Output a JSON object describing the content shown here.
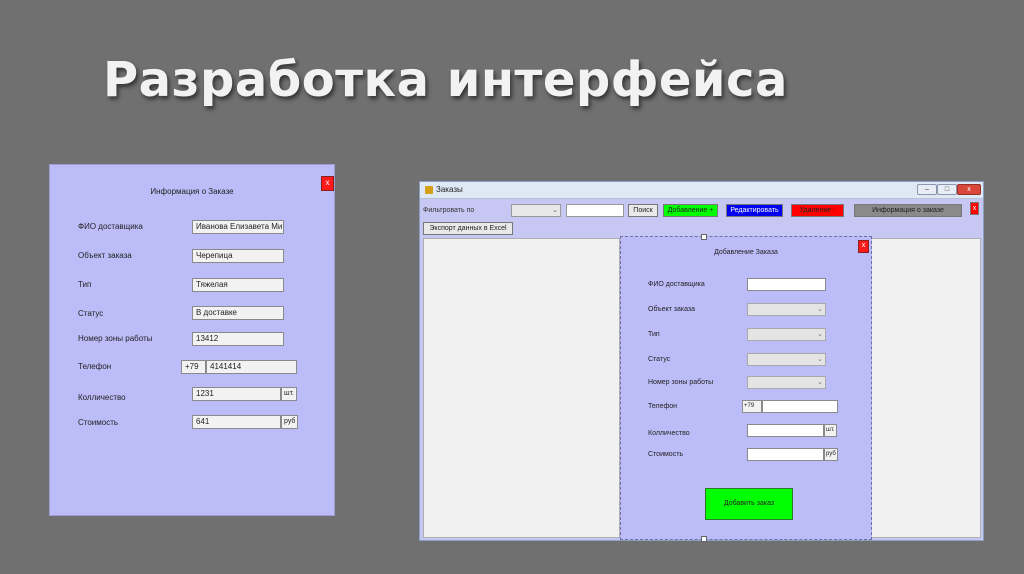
{
  "slide": {
    "title": "Разработка интерфейса"
  },
  "info_form": {
    "title": "Информация о Заказе",
    "close_label": "x",
    "fields": {
      "fio_label": "ФИО доставщика",
      "fio_value": "Иванова Елизавета Ми",
      "object_label": "Объект заказа",
      "object_value": "Черепица",
      "type_label": "Тип",
      "type_value": "Тяжелая",
      "status_label": "Статус",
      "status_value": "В доставке",
      "zone_label": "Номер зоны работы",
      "zone_value": "13412",
      "phone_label": "Телефон",
      "phone_prefix": "+79",
      "phone_value": "4141414",
      "qty_label": "Колличество",
      "qty_value": "1231",
      "qty_unit": "шт.",
      "cost_label": "Стоимость",
      "cost_value": "641",
      "cost_unit": "руб"
    }
  },
  "orders_window": {
    "title": "Заказы",
    "minimize": "–",
    "maximize": "□",
    "close": "x",
    "toolbar": {
      "filter_label": "Фильтровать по",
      "search_button": "Поиск",
      "add_button": "Добавление +",
      "edit_button": "Редактировать",
      "delete_button": "Удаление -",
      "info_button": "Информация о заказе",
      "close_button": "x",
      "export_button": "Экспорт данных в Excel"
    },
    "colors": {
      "add": "#00ff00",
      "edit": "#0000ee",
      "delete": "#ff0000",
      "info": "#8a8a8a"
    },
    "add_form": {
      "title": "Добавление Заказа",
      "close_label": "x",
      "fio_label": "ФИО доставщика",
      "object_label": "Объект заказа",
      "type_label": "Тип",
      "status_label": "Статус",
      "zone_label": "Номер зоны работы",
      "phone_label": "Телефон",
      "phone_prefix": "+79",
      "qty_label": "Колличество",
      "qty_unit": "шт.",
      "cost_label": "Стоимость",
      "cost_unit": "руб",
      "submit_label": "Добавить заказ"
    }
  }
}
